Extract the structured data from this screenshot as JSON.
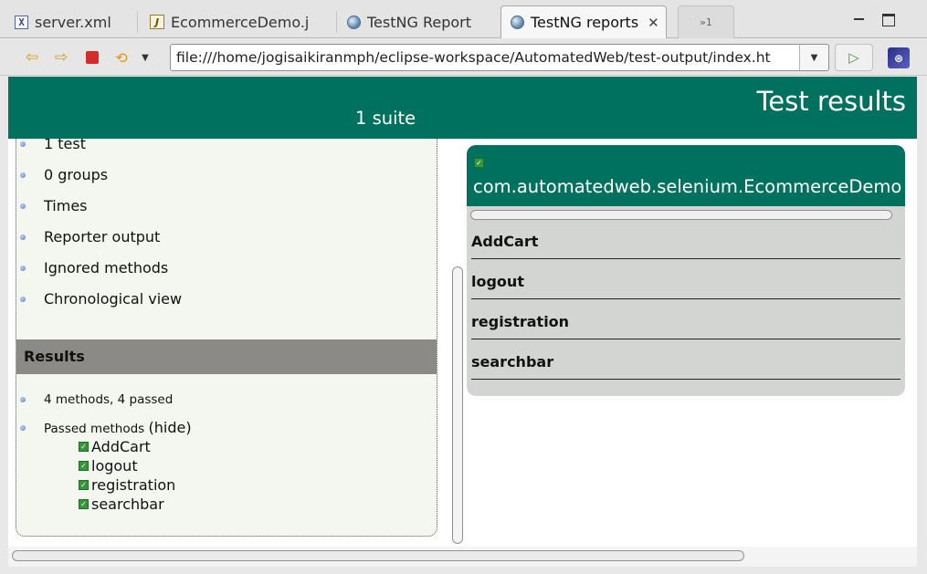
{
  "tabs": [
    {
      "label": "server.xml",
      "icon": "xml-file-icon"
    },
    {
      "label": "EcommerceDemo.j",
      "icon": "java-file-icon"
    },
    {
      "label": "TestNG Report",
      "icon": "globe-icon"
    },
    {
      "label": "TestNG reports",
      "icon": "globe-icon",
      "active": true
    }
  ],
  "overflow_tabs": "»1",
  "toolbar": {
    "url": "file:///home/jogisaikiranmph/eclipse-workspace/AutomatedWeb/test-output/index.ht"
  },
  "report": {
    "title": "Test results",
    "suite_count": "1 suite",
    "nav_items": [
      "1 test",
      "0 groups",
      "Times",
      "Reporter output",
      "Ignored methods",
      "Chronological view"
    ],
    "results_header": "Results",
    "summary": "4 methods, 4 passed",
    "passed_label": "Passed methods",
    "hide_link": "(hide)",
    "passed_methods": [
      "AddCart",
      "logout",
      "registration",
      "searchbar"
    ],
    "class_name": "com.automatedweb.selenium.EcommerceDemo",
    "class_methods": [
      "AddCart",
      "logout",
      "registration",
      "searchbar"
    ]
  },
  "colors": {
    "header_green": "#00705f",
    "results_gray": "#8b8a86",
    "class_panel_bg": "#d2d5d2",
    "pass_green": "#36963a"
  }
}
